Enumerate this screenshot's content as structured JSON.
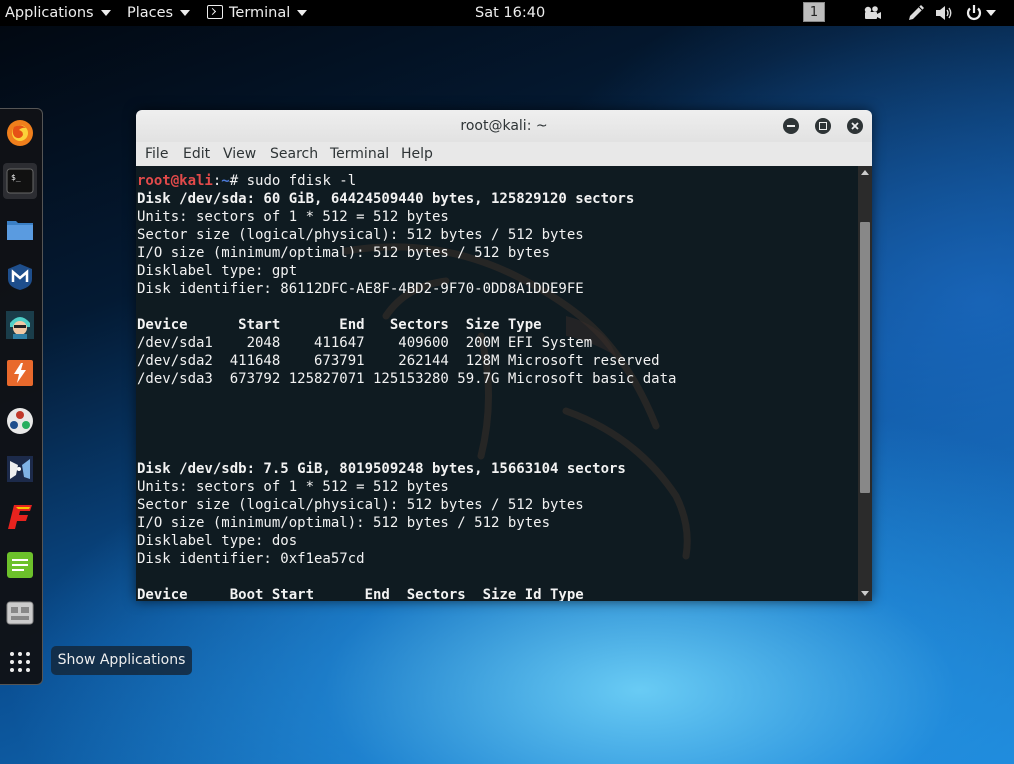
{
  "top_panel": {
    "applications_label": "Applications",
    "places_label": "Places",
    "terminal_label": "Terminal",
    "clock": "Sat 16:40",
    "workspace": "1"
  },
  "dock": {
    "tooltip": "Show Applications",
    "items": [
      "firefox-icon",
      "terminal-icon",
      "files-icon",
      "metasploit-icon",
      "armitage-icon",
      "burpsuite-icon",
      "maltego-icon",
      "beef-icon",
      "faraday-icon",
      "leafpad-icon",
      "cutycapt-icon",
      "show-applications-icon"
    ]
  },
  "window": {
    "title": "root@kali: ~",
    "menu": [
      "File",
      "Edit",
      "View",
      "Search",
      "Terminal",
      "Help"
    ]
  },
  "terminal": {
    "prompt_user": "root@kali",
    "prompt_sep": ":",
    "prompt_path": "~",
    "prompt_suffix": "# sudo fdisk -l",
    "lines": [
      "Disk /dev/sda: 60 GiB, 64424509440 bytes, 125829120 sectors",
      "Units: sectors of 1 * 512 = 512 bytes",
      "Sector size (logical/physical): 512 bytes / 512 bytes",
      "I/O size (minimum/optimal): 512 bytes / 512 bytes",
      "Disklabel type: gpt",
      "Disk identifier: 86112DFC-AE8F-4BD2-9F70-0DD8A1DDE9FE",
      "",
      "Device      Start       End   Sectors  Size Type",
      "/dev/sda1    2048    411647    409600  200M EFI System",
      "/dev/sda2  411648    673791    262144  128M Microsoft reserved",
      "/dev/sda3  673792 125827071 125153280 59.7G Microsoft basic data",
      "",
      "",
      "",
      "",
      "Disk /dev/sdb: 7.5 GiB, 8019509248 bytes, 15663104 sectors",
      "Units: sectors of 1 * 512 = 512 bytes",
      "Sector size (logical/physical): 512 bytes / 512 bytes",
      "I/O size (minimum/optimal): 512 bytes / 512 bytes",
      "Disklabel type: dos",
      "Disk identifier: 0xf1ea57cd",
      "",
      "Device     Boot Start      End  Sectors  Size Id Type"
    ]
  },
  "colors": {
    "terminal_bg": "#0f1b21",
    "prompt_user": "#e24a4a",
    "prompt_path": "#4c7ad8"
  }
}
